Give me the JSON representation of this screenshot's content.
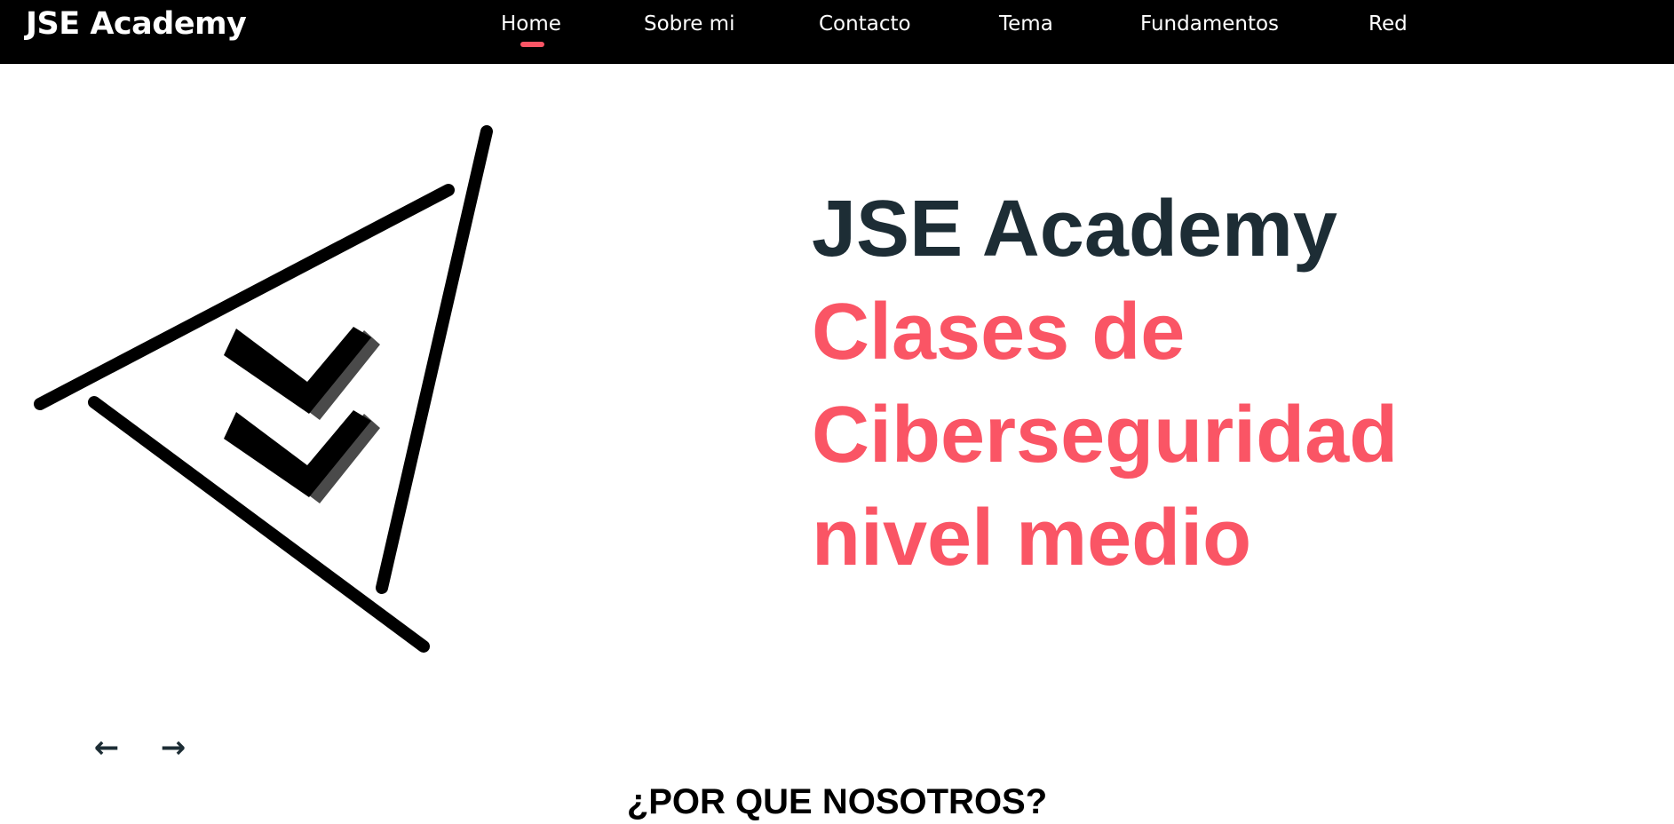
{
  "brand": {
    "name": "JSE Academy"
  },
  "nav": {
    "items": [
      {
        "label": "Home",
        "active": true
      },
      {
        "label": "Sobre mi",
        "active": false
      },
      {
        "label": "Contacto",
        "active": false
      },
      {
        "label": "Tema",
        "active": false
      },
      {
        "label": "Fundamentos",
        "active": false
      },
      {
        "label": "Red",
        "active": false
      }
    ]
  },
  "hero": {
    "title": "JSE Academy",
    "subtitle_lines": [
      "Clases de",
      "Ciberseguridad",
      "nivel medio"
    ],
    "illustration_icon": "triangle-double-check-icon"
  },
  "carousel": {
    "prev_symbol": "←",
    "next_symbol": "→",
    "prev_icon": "arrow-left-icon",
    "next_icon": "arrow-right-icon"
  },
  "section": {
    "heading": "¿POR QUE NOSOTROS?"
  },
  "colors": {
    "nav_bg": "#000000",
    "accent": "#fa5565",
    "title": "#1d2d35",
    "background": "#ffffff"
  }
}
